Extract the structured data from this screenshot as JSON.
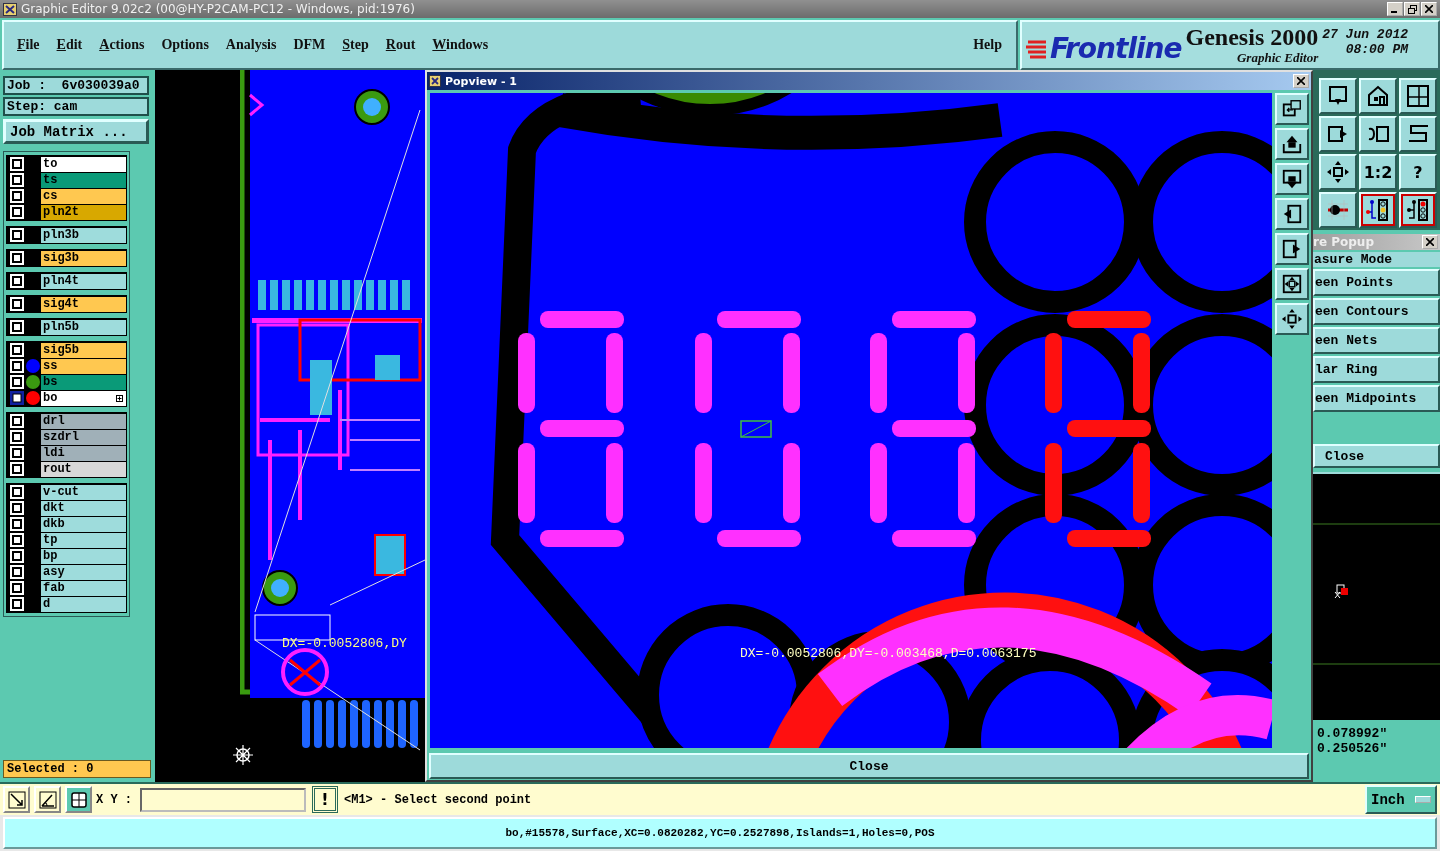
{
  "window": {
    "title": "Graphic Editor 9.02c2 (00@HY-P2CAM-PC12 - Windows, pid:1976)"
  },
  "menu": [
    {
      "label": "File",
      "underlined": true
    },
    {
      "label": "Edit",
      "underlined": true
    },
    {
      "label": "Actions",
      "underlined": true
    },
    {
      "label": "Options",
      "underlined": false
    },
    {
      "label": "Analysis",
      "underlined": false
    },
    {
      "label": "DFM",
      "underlined": false
    },
    {
      "label": "Step",
      "underlined": true
    },
    {
      "label": "Rout",
      "underlined": true
    },
    {
      "label": "Windows",
      "underlined": true
    }
  ],
  "help": "Help",
  "logo": {
    "brand": "Frontline",
    "product": "Genesis 2000",
    "subtitle": "Graphic Editor",
    "date": "27 Jun 2012",
    "time": "08:00 PM"
  },
  "job": {
    "job": "Job :  6v030039a0",
    "step": "Step: cam",
    "matrix_button": "Job Matrix ..."
  },
  "layer_groups": [
    {
      "layers": [
        {
          "name": "to",
          "color": "#ffffff",
          "selected": false
        },
        {
          "name": "ts",
          "color": "#0a9a78",
          "selected": false
        },
        {
          "name": "cs",
          "color": "#ffc850",
          "selected": false
        },
        {
          "name": "pln2t",
          "color": "#d8a800",
          "selected": false
        }
      ]
    },
    {
      "layers": [
        {
          "name": "pln3b",
          "color": "#9edcdc",
          "selected": false
        }
      ]
    },
    {
      "layers": [
        {
          "name": "sig3b",
          "color": "#ffc850",
          "selected": false
        }
      ]
    },
    {
      "layers": [
        {
          "name": "pln4t",
          "color": "#9edcdc",
          "selected": false
        }
      ]
    },
    {
      "layers": [
        {
          "name": "sig4t",
          "color": "#ffc850",
          "selected": false
        }
      ]
    },
    {
      "layers": [
        {
          "name": "pln5b",
          "color": "#9edcdc",
          "selected": false
        }
      ]
    },
    {
      "layers": [
        {
          "name": "sig5b",
          "color": "#ffc850",
          "selected": false
        },
        {
          "name": "ss",
          "color": "#ffc850",
          "selected": false,
          "marker": {
            "color": "#0000ff"
          }
        },
        {
          "name": "bs",
          "color": "#0a9a78",
          "selected": false,
          "marker": {
            "color": "#3a9a10"
          }
        },
        {
          "name": "bo",
          "color": "#ffffff",
          "selected": true,
          "marker": {
            "color": "#ff0000"
          }
        }
      ]
    },
    {
      "layers": [
        {
          "name": "drl",
          "color": "#a0b0b8",
          "selected": false
        },
        {
          "name": "szdrl",
          "color": "#a0b0b8",
          "selected": false
        },
        {
          "name": "ldi",
          "color": "#a0b0b8",
          "selected": false
        },
        {
          "name": "rout",
          "color": "#d8d8d8",
          "selected": false
        }
      ]
    },
    {
      "layers": [
        {
          "name": "v-cut",
          "color": "#9edcdc",
          "selected": false
        },
        {
          "name": "dkt",
          "color": "#9edcdc",
          "selected": false
        },
        {
          "name": "dkb",
          "color": "#9edcdc",
          "selected": false
        },
        {
          "name": "tp",
          "color": "#9edcdc",
          "selected": false
        },
        {
          "name": "bp",
          "color": "#9edcdc",
          "selected": false
        },
        {
          "name": "asy",
          "color": "#9edcdc",
          "selected": false
        },
        {
          "name": "fab",
          "color": "#9edcdc",
          "selected": false
        },
        {
          "name": "d",
          "color": "#9edcdc",
          "selected": false
        }
      ]
    }
  ],
  "selected_count": "Selected : 0",
  "board": {
    "measure_text": "DX=-0.0052806,DY"
  },
  "popview": {
    "title": "Popview - 1",
    "measure_text": "DX=-0.0052806,DY=-0.003468,D=0.0063175",
    "close_button": "Close"
  },
  "toolbar": {
    "labels": [
      "1:2",
      "?"
    ]
  },
  "measure_popup": {
    "title": "re Popup",
    "heading": "asure Mode",
    "options": [
      {
        "label": "een Points",
        "selected": false
      },
      {
        "label": "een Contours",
        "selected": false
      },
      {
        "label": "een Nets",
        "selected": false
      },
      {
        "label": "lar Ring",
        "selected": false
      },
      {
        "label": "een Midpoints",
        "selected": false
      }
    ],
    "close_button": "Close"
  },
  "coordinates": [
    "0.078992\"",
    "0.250526\""
  ],
  "command": {
    "xy_label": "X Y :",
    "execute_button": "!",
    "prompt": "<M1> - Select second point",
    "units_button": "Inch"
  },
  "status_bar": "bo,#15578,Surface,XC=0.0820282,YC=0.2527898,Islands=1,Holes=0,POS"
}
